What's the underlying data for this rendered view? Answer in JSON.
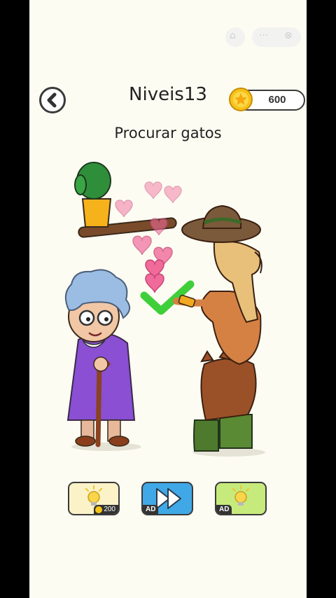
{
  "header": {
    "level_title": "Niveis13",
    "coins": "600",
    "back_icon": "chevron-left-icon",
    "coin_icon": "star-coin-icon"
  },
  "task": {
    "instruction": "Procurar gatos"
  },
  "miniapp_capsule": {
    "home_icon": "home-icon",
    "more_icon": "more-dots-icon",
    "close_icon": "close-circle-icon"
  },
  "footer": {
    "hint": {
      "icon": "lightbulb-icon",
      "cost": "200"
    },
    "skip": {
      "icon": "fast-forward-icon",
      "badge": "AD"
    },
    "ad_hint": {
      "icon": "lightbulb-icon",
      "badge": "AD"
    }
  },
  "status": {
    "solved": true,
    "check_icon": "checkmark-icon"
  },
  "colors": {
    "background": "#fdfcf3",
    "accent_green": "#3fcf3a",
    "skip_blue": "#40a8e6",
    "hint_yellow": "#fbf2c8",
    "ad_hint_green": "#c7ea7c"
  }
}
